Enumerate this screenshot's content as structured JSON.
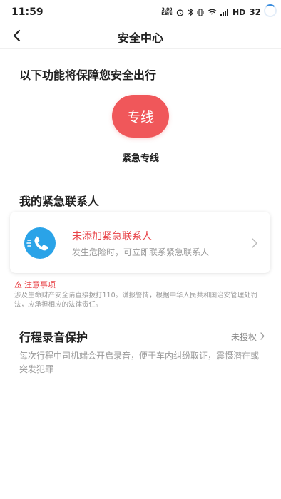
{
  "status_bar": {
    "time": "11:59",
    "net_speed_top": "3.88",
    "net_speed_bottom": "KB/S",
    "network": "HD",
    "battery": "32"
  },
  "nav": {
    "title": "安全中心"
  },
  "safety": {
    "heading": "以下功能将保障您安全出行",
    "hotline_button": "专线",
    "hotline_label": "紧急专线"
  },
  "contacts": {
    "heading": "我的紧急联系人",
    "card_title": "未添加紧急联系人",
    "card_desc": "发生危险时，可立即联系紧急联系人"
  },
  "notice": {
    "title": "注意事项",
    "text": "涉及生命财产安全请直接拨打110。谎报警情，根据中华人民共和国治安管理处罚法，应承担相应的法律责任。"
  },
  "recording": {
    "heading": "行程录音保护",
    "status": "未授权",
    "desc": "每次行程中司机端会开启录音，便于车内纠纷取证，震慑潜在或突发犯罪"
  },
  "colors": {
    "accent_red": "#f0575a",
    "phone_blue": "#2aa3e8",
    "warning_red": "#e8454a"
  }
}
